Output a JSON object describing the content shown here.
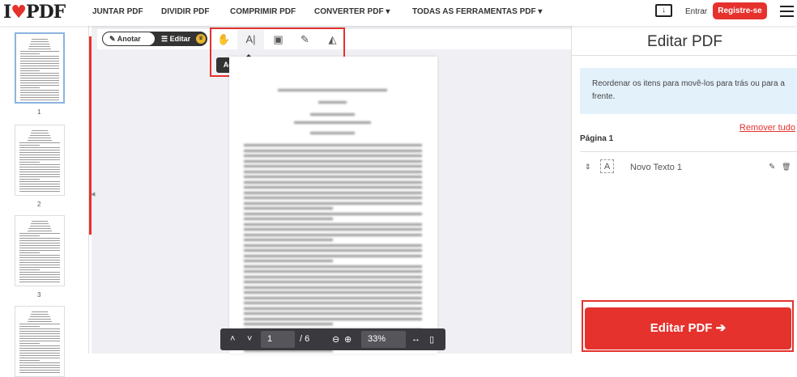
{
  "header": {
    "logo": "I♥PDF",
    "nav": [
      "JUNTAR PDF",
      "DIVIDIR PDF",
      "COMPRIMIR PDF",
      "CONVERTER PDF ▾",
      "TODAS AS FERRAMENTAS PDF ▾"
    ],
    "login": "Entrar",
    "register": "Registre-se"
  },
  "thumbnails": [
    "1",
    "2",
    "3"
  ],
  "toolbar": {
    "annotate": "Anotar",
    "edit": "Editar",
    "tooltip": "Adicionar texto"
  },
  "pager": {
    "current": "1",
    "total": "/ 6",
    "zoom": "33%"
  },
  "panel": {
    "title": "Editar PDF",
    "info": "Reordenar os itens para movê-los para trás ou para a frente.",
    "remove_all": "Remover tudo",
    "page_label": "Página 1",
    "item": "Novo Texto 1",
    "action": "Editar PDF"
  },
  "colors": {
    "accent": "#e5322d",
    "info_bg": "#e3f1fb"
  }
}
